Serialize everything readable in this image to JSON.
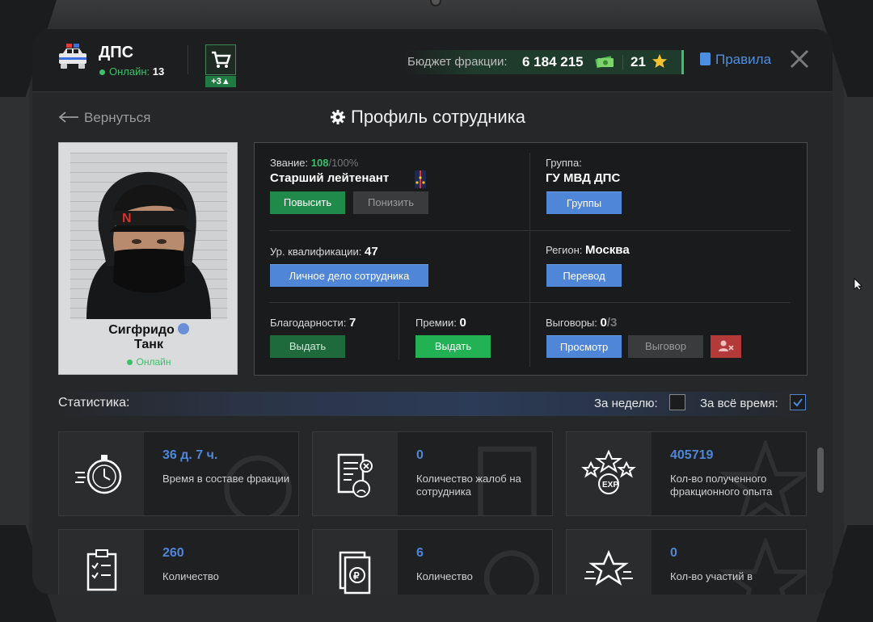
{
  "header": {
    "faction_name": "ДПС",
    "online_label": "Онлайн:",
    "online_count": "13",
    "cart_badge": "+3▲",
    "budget_label": "Бюджет фракции:",
    "budget_value": "6 184 215",
    "stars_value": "21",
    "rules_label": "Правила"
  },
  "nav": {
    "back_label": "Вернуться",
    "page_title": "Профиль сотрудника"
  },
  "person": {
    "name_line1": "Сигфридо",
    "name_line2": "Танк",
    "status": "Онлайн"
  },
  "profile": {
    "rank_label": "Звание:",
    "rank_progress": "108",
    "rank_progress_max": "/100%",
    "rank_name": "Старший лейтенант",
    "promote_btn": "Повысить",
    "demote_btn": "Понизить",
    "group_label": "Группа:",
    "group_name": "ГУ МВД ДПС",
    "groups_btn": "Группы",
    "qual_label": "Ур. квалификации:",
    "qual_value": "47",
    "personal_file_btn": "Личное дело сотрудника",
    "region_label": "Регион:",
    "region_value": "Москва",
    "transfer_btn": "Перевод",
    "thanks_label": "Благодарности:",
    "thanks_value": "7",
    "thanks_btn": "Выдать",
    "bonus_label": "Премии:",
    "bonus_value": "0",
    "bonus_btn": "Выдать",
    "reprimand_label": "Выговоры:",
    "reprimand_value": "0",
    "reprimand_max": "/3",
    "view_btn": "Просмотр",
    "reprimand_btn": "Выговор"
  },
  "stats": {
    "title": "Статистика:",
    "week_label": "За неделю:",
    "all_time_label": "За всё время:",
    "cards": [
      {
        "value": "36 д. 7 ч.",
        "desc": "Время в составе фракции",
        "icon": "stopwatch-icon"
      },
      {
        "value": "0",
        "desc": "Количество жалоб на сотрудника",
        "icon": "complaint-document-icon"
      },
      {
        "value": "405719",
        "desc": "Кол-во полученного фракционного опыта",
        "icon": "exp-stars-icon"
      },
      {
        "value": "260",
        "desc": "Количество",
        "icon": "clipboard-checklist-icon"
      },
      {
        "value": "6",
        "desc": "Количество",
        "icon": "ruble-document-icon"
      },
      {
        "value": "0",
        "desc": "Кол-во участий в",
        "icon": "star-speed-icon"
      }
    ]
  },
  "colors": {
    "accent_blue": "#4f86d8",
    "accent_green": "#3cc06a",
    "background": "#262728"
  }
}
